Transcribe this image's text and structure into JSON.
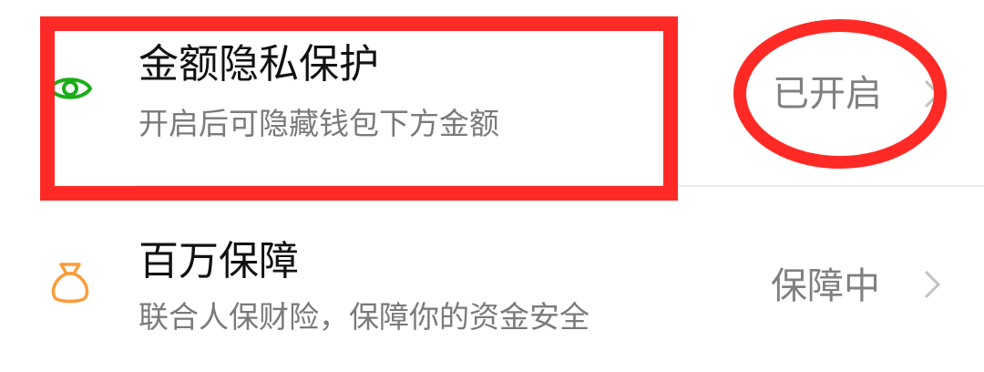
{
  "settings": {
    "privacy": {
      "title": "金额隐私保护",
      "subtitle": "开启后可隐藏钱包下方金额",
      "status": "已开启",
      "icon": "eye-icon",
      "icon_color": "#1aad19"
    },
    "insurance": {
      "title": "百万保障",
      "subtitle": "联合人保财险，保障你的资金安全",
      "status": "保障中",
      "icon": "money-bag-icon",
      "icon_color": "#fa9d3b"
    }
  },
  "annotations": {
    "color": "#ff2a25",
    "highlight_box": "rectangle",
    "highlight_status": "ellipse"
  }
}
